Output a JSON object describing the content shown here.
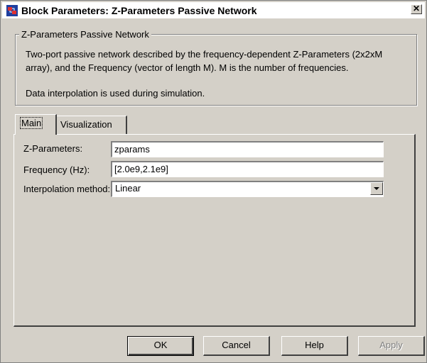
{
  "window": {
    "title": "Block Parameters: Z-Parameters Passive Network",
    "close_label": "✕",
    "icon": "simulink-block-icon"
  },
  "group": {
    "legend": "Z-Parameters Passive Network",
    "description_line1": "Two-port passive network described by the frequency-dependent Z-Parameters (2x2xM",
    "description_line2": "array), and the Frequency (vector of length M).  M is the number of frequencies.",
    "description_line3": "Data interpolation is used during simulation."
  },
  "tabs": [
    {
      "label": "Main",
      "selected": true
    },
    {
      "label": "Visualization",
      "selected": false
    }
  ],
  "fields": {
    "zparams_label": "Z-Parameters:",
    "zparams_value": "zparams",
    "frequency_label": "Frequency (Hz):",
    "frequency_value": "[2.0e9,2.1e9]",
    "interp_label": "Interpolation method:",
    "interp_value": "Linear"
  },
  "buttons": {
    "ok": "OK",
    "cancel": "Cancel",
    "help": "Help",
    "apply": "Apply"
  }
}
